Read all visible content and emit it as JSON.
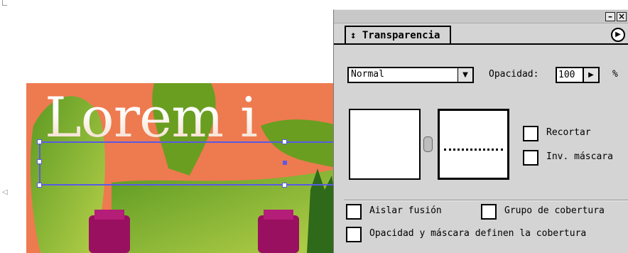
{
  "canvas": {
    "art_text": "Lorem i"
  },
  "panel": {
    "tab_label": "↕ Transparencia",
    "minimize_label": "–",
    "close_label": "×",
    "menu_icon": "▶",
    "blend_mode": {
      "value": "Normal",
      "arrow": "▼"
    },
    "opacity": {
      "label": "Opacidad:",
      "value": "100",
      "arrow": "▶",
      "unit": "%"
    },
    "checkboxes": {
      "recortar": "Recortar",
      "inv_mascara": "Inv. máscara",
      "aislar_fusion": "Aislar fusión",
      "grupo_cobertura": "Grupo de cobertura",
      "opacidad_mascara": "Opacidad y máscara definen la cobertura"
    }
  },
  "colors": {
    "panel_bg": "#d4d4d4",
    "artwork_orange": "#ee7a50",
    "artwork_green": "#7ab02a",
    "selection": "#5a5ae6",
    "bottle": "#9a1060"
  }
}
